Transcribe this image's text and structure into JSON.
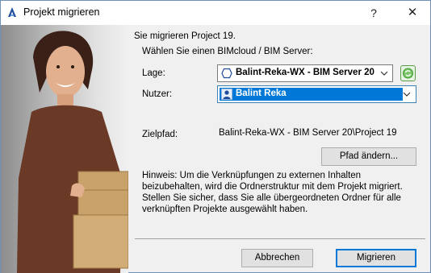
{
  "window": {
    "title": "Projekt migrieren",
    "help_label": "?",
    "close_label": "✕"
  },
  "intro": {
    "line1": "Sie migrieren Project 19.",
    "line2": "Wählen Sie einen BIMcloud / BIM Server:"
  },
  "location": {
    "label": "Lage:",
    "value": "Balint-Reka-WX - BIM Server 20"
  },
  "user": {
    "label": "Nutzer:",
    "value": "Balint Reka"
  },
  "target": {
    "label": "Zielpfad:",
    "value": "Balint-Reka-WX - BIM Server 20\\Project 19"
  },
  "buttons": {
    "change_path": "Pfad ändern...",
    "cancel": "Abbrechen",
    "migrate": "Migrieren"
  },
  "hint": {
    "text": "Hinweis: Um die Verknüpfungen zu externen Inhalten beizubehalten, wird die Ordnerstruktur mit dem Projekt migriert. Stellen Sie sicher, dass Sie alle übergeordneten Ordner für alle verknüpften Projekte ausgewählt haben."
  },
  "colors": {
    "selection": "#0078d7",
    "refresh_green": "#3c9c2c"
  },
  "icons": {
    "app": "archicad-icon",
    "server": "server-hexagon-icon",
    "user": "user-icon",
    "refresh": "refresh-icon",
    "dropdown": "chevron-down-icon"
  }
}
